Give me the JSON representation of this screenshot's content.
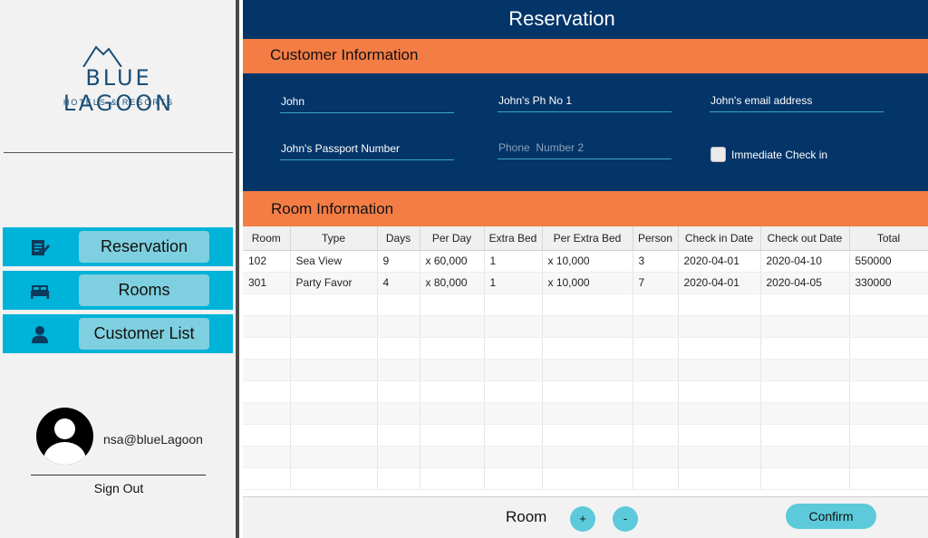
{
  "sidebar": {
    "logo": {
      "brand": "BLUE LAGOON",
      "tagline": "HOTELS & RESORTS"
    },
    "nav": [
      {
        "label": "Reservation",
        "icon": "edit-document-icon"
      },
      {
        "label": "Rooms",
        "icon": "bed-icon"
      },
      {
        "label": "Customer List",
        "icon": "person-icon"
      }
    ],
    "user": {
      "name": "nsa@blueLagoon",
      "sign_out": "Sign Out"
    }
  },
  "main": {
    "title": "Reservation",
    "customer_section": {
      "header": "Customer Information",
      "fields": {
        "name": {
          "value": "John",
          "placeholder": ""
        },
        "phone1": {
          "value": "John's Ph No 1",
          "placeholder": ""
        },
        "email": {
          "value": "John's email address",
          "placeholder": ""
        },
        "passport": {
          "value": "John's Passport Number",
          "placeholder": ""
        },
        "phone2": {
          "value": "",
          "placeholder": "Phone  Number 2"
        }
      },
      "checkin_label": "Immediate Check in",
      "checkin_checked": false
    },
    "room_section": {
      "header": "Room Information",
      "columns": [
        "Room",
        "Type",
        "Days",
        "Per Day",
        "Extra Bed",
        "Per Extra Bed",
        "Person",
        "Check in Date",
        "Check out Date",
        "Total"
      ],
      "rows": [
        [
          "102",
          "Sea View",
          "9",
          "x 60,000",
          "1",
          "x 10,000",
          "3",
          "2020-04-01",
          "2020-04-10",
          "550000"
        ],
        [
          "301",
          "Party Favor",
          "4",
          "x 80,000",
          "1",
          "x 10,000",
          "7",
          "2020-04-01",
          "2020-04-05",
          "330000"
        ]
      ]
    },
    "footer": {
      "room_label": "Room",
      "add": "+",
      "remove": "-",
      "confirm": "Confirm"
    }
  },
  "colors": {
    "navy": "#043569",
    "orange": "#f47d46",
    "cyan": "#00b3d9",
    "button": "#5ccada"
  }
}
